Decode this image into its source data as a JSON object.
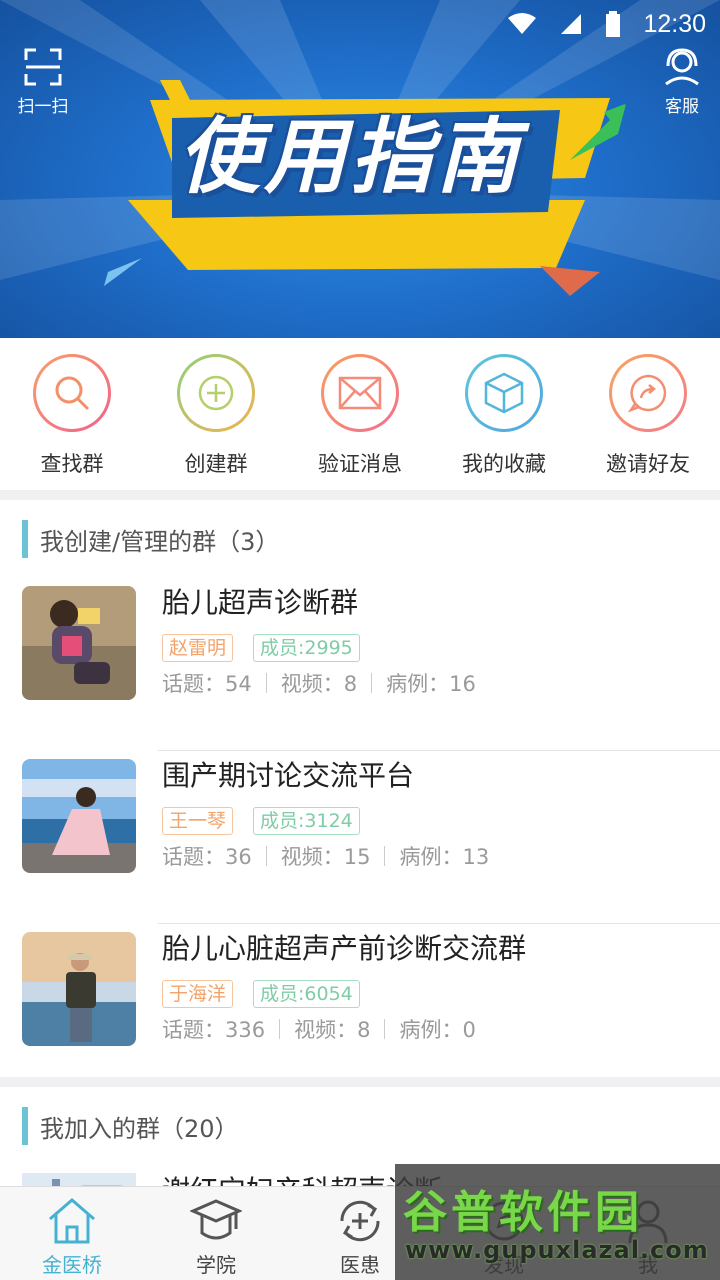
{
  "status_bar": {
    "time": "12:30"
  },
  "header": {
    "scan_label": "扫一扫",
    "service_label": "客服",
    "banner_title": "使用指南"
  },
  "quick_actions": [
    {
      "label": "查找群",
      "icon": "search-icon",
      "color_start": "#f7a26b",
      "color_end": "#f25f8a"
    },
    {
      "label": "创建群",
      "icon": "plus-circle-icon",
      "color_start": "#8fd07a",
      "color_end": "#f3b24f"
    },
    {
      "label": "验证消息",
      "icon": "mail-icon",
      "color_start": "#f9a05b",
      "color_end": "#f56d8f"
    },
    {
      "label": "我的收藏",
      "icon": "box-icon",
      "color_start": "#5fc8d8",
      "color_end": "#4fa6e0"
    },
    {
      "label": "邀请好友",
      "icon": "share-bubble-icon",
      "color_start": "#f8a460",
      "color_end": "#f47b86"
    }
  ],
  "created_section": {
    "title": "我创建/管理的群（3）",
    "groups": [
      {
        "name": "胎儿超声诊断群",
        "owner": "赵雷明",
        "members": "成员:2995",
        "topics": "话题：54",
        "videos": "视频：8",
        "cases": "病例：16"
      },
      {
        "name": "围产期讨论交流平台",
        "owner": "王一琴",
        "members": "成员:3124",
        "topics": "话题：36",
        "videos": "视频：15",
        "cases": "病例：13"
      },
      {
        "name": "胎儿心脏超声产前诊断交流群",
        "owner": "于海洋",
        "members": "成员:6054",
        "topics": "话题：336",
        "videos": "视频：8",
        "cases": "病例：0"
      }
    ]
  },
  "joined_section": {
    "title": "我加入的群（20）",
    "first_group_name": "谢红宁妇产科超声诊断"
  },
  "tab_bar": {
    "tabs": [
      {
        "label": "金医桥",
        "icon": "home-icon",
        "active": true
      },
      {
        "label": "学院",
        "icon": "graduation-cap-icon",
        "active": false
      },
      {
        "label": "医患",
        "icon": "refresh-plus-icon",
        "active": false
      },
      {
        "label": "发现",
        "icon": "compass-icon",
        "active": false
      },
      {
        "label": "我",
        "icon": "person-icon",
        "active": false
      }
    ]
  },
  "watermark": {
    "title": "谷普软件园",
    "url": "www.gupuxlazal.com"
  },
  "colors": {
    "accent": "#45b2d2",
    "section_bar": "#6cc3d6",
    "owner_tag": "#f3a36b",
    "member_tag": "#7fcca5"
  }
}
